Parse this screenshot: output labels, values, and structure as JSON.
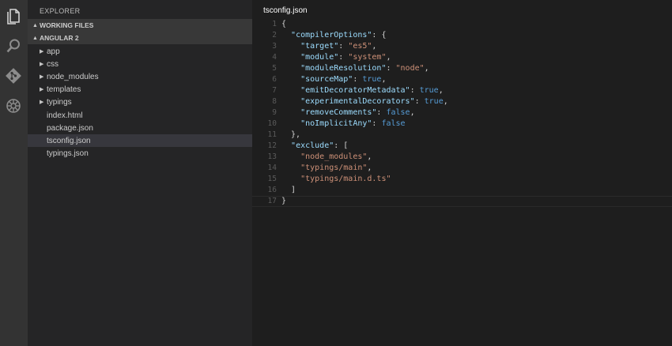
{
  "activity_bar": {
    "icons": [
      "files-icon",
      "search-icon",
      "git-icon",
      "debug-icon"
    ]
  },
  "sidebar": {
    "title": "EXPLORER",
    "working_files": "WORKING FILES",
    "project": "ANGULAR 2",
    "folders": [
      "app",
      "css",
      "node_modules",
      "templates",
      "typings"
    ],
    "files": [
      "index.html",
      "package.json",
      "tsconfig.json",
      "typings.json"
    ],
    "selected_file": "tsconfig.json"
  },
  "editor": {
    "tab_title": "tsconfig.json",
    "line_numbers": [
      "1",
      "2",
      "3",
      "4",
      "5",
      "6",
      "7",
      "8",
      "9",
      "10",
      "11",
      "12",
      "13",
      "14",
      "15",
      "16",
      "17"
    ],
    "lines": [
      [
        {
          "t": "{",
          "c": "p"
        }
      ],
      [
        {
          "t": "  ",
          "c": "p"
        },
        {
          "t": "\"compilerOptions\"",
          "c": "k"
        },
        {
          "t": ": {",
          "c": "p"
        }
      ],
      [
        {
          "t": "    ",
          "c": "p"
        },
        {
          "t": "\"target\"",
          "c": "k"
        },
        {
          "t": ": ",
          "c": "p"
        },
        {
          "t": "\"es5\"",
          "c": "s"
        },
        {
          "t": ",",
          "c": "p"
        }
      ],
      [
        {
          "t": "    ",
          "c": "p"
        },
        {
          "t": "\"module\"",
          "c": "k"
        },
        {
          "t": ": ",
          "c": "p"
        },
        {
          "t": "\"system\"",
          "c": "s"
        },
        {
          "t": ",",
          "c": "p"
        }
      ],
      [
        {
          "t": "    ",
          "c": "p"
        },
        {
          "t": "\"moduleResolution\"",
          "c": "k"
        },
        {
          "t": ": ",
          "c": "p"
        },
        {
          "t": "\"node\"",
          "c": "s"
        },
        {
          "t": ",",
          "c": "p"
        }
      ],
      [
        {
          "t": "    ",
          "c": "p"
        },
        {
          "t": "\"sourceMap\"",
          "c": "k"
        },
        {
          "t": ": ",
          "c": "p"
        },
        {
          "t": "true",
          "c": "b"
        },
        {
          "t": ",",
          "c": "p"
        }
      ],
      [
        {
          "t": "    ",
          "c": "p"
        },
        {
          "t": "\"emitDecoratorMetadata\"",
          "c": "k"
        },
        {
          "t": ": ",
          "c": "p"
        },
        {
          "t": "true",
          "c": "b"
        },
        {
          "t": ",",
          "c": "p"
        }
      ],
      [
        {
          "t": "    ",
          "c": "p"
        },
        {
          "t": "\"experimentalDecorators\"",
          "c": "k"
        },
        {
          "t": ": ",
          "c": "p"
        },
        {
          "t": "true",
          "c": "b"
        },
        {
          "t": ",",
          "c": "p"
        }
      ],
      [
        {
          "t": "    ",
          "c": "p"
        },
        {
          "t": "\"removeComments\"",
          "c": "k"
        },
        {
          "t": ": ",
          "c": "p"
        },
        {
          "t": "false",
          "c": "b"
        },
        {
          "t": ",",
          "c": "p"
        }
      ],
      [
        {
          "t": "    ",
          "c": "p"
        },
        {
          "t": "\"noImplicitAny\"",
          "c": "k"
        },
        {
          "t": ": ",
          "c": "p"
        },
        {
          "t": "false",
          "c": "b"
        }
      ],
      [
        {
          "t": "  },",
          "c": "p"
        }
      ],
      [
        {
          "t": "  ",
          "c": "p"
        },
        {
          "t": "\"exclude\"",
          "c": "k"
        },
        {
          "t": ": [",
          "c": "p"
        }
      ],
      [
        {
          "t": "    ",
          "c": "p"
        },
        {
          "t": "\"node_modules\"",
          "c": "s"
        },
        {
          "t": ",",
          "c": "p"
        }
      ],
      [
        {
          "t": "    ",
          "c": "p"
        },
        {
          "t": "\"typings/main\"",
          "c": "s"
        },
        {
          "t": ",",
          "c": "p"
        }
      ],
      [
        {
          "t": "    ",
          "c": "p"
        },
        {
          "t": "\"typings/main.d.ts\"",
          "c": "s"
        }
      ],
      [
        {
          "t": "  ]",
          "c": "p"
        }
      ],
      [
        {
          "t": "}",
          "c": "p"
        }
      ]
    ],
    "current_line": 17
  },
  "colors": {
    "activity_bar": "#333333",
    "sidebar": "#252526",
    "editor": "#1e1e1e",
    "key": "#9cdcfe",
    "string": "#ce9178",
    "boolean": "#569cd6"
  }
}
